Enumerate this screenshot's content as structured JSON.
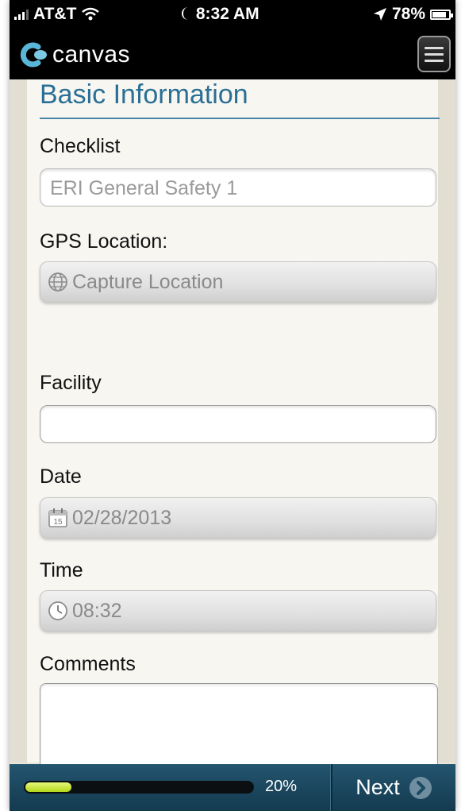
{
  "status_bar": {
    "carrier": "AT&T",
    "time": "8:32 AM",
    "battery": "78%",
    "battery_level": 0.78,
    "signal_icon": "signal-bars-icon",
    "wifi_icon": "wifi-icon",
    "moon_icon": "moon-icon",
    "location_icon": "location-arrow-icon"
  },
  "app": {
    "name": "canvas",
    "menu_icon": "hamburger-menu-icon"
  },
  "form": {
    "section_title": "Basic Information",
    "checklist": {
      "label": "Checklist",
      "value": "ERI General Safety 1"
    },
    "gps": {
      "label": "GPS Location:",
      "button": "Capture Location",
      "icon": "globe-icon"
    },
    "facility": {
      "label": "Facility",
      "value": ""
    },
    "date": {
      "label": "Date",
      "value": "02/28/2013",
      "icon": "calendar-icon",
      "icon_day": "15"
    },
    "time": {
      "label": "Time",
      "value": "08:32",
      "icon": "clock-icon"
    },
    "comments": {
      "label": "Comments",
      "value": ""
    }
  },
  "footer": {
    "progress_text": "20%",
    "progress_fraction": 0.2,
    "next_label": "Next",
    "next_icon": "chevron-right-circle-icon"
  },
  "colors": {
    "accent": "#2a6f95",
    "progress": "#c3e02a",
    "footer": "#1c4a63"
  }
}
